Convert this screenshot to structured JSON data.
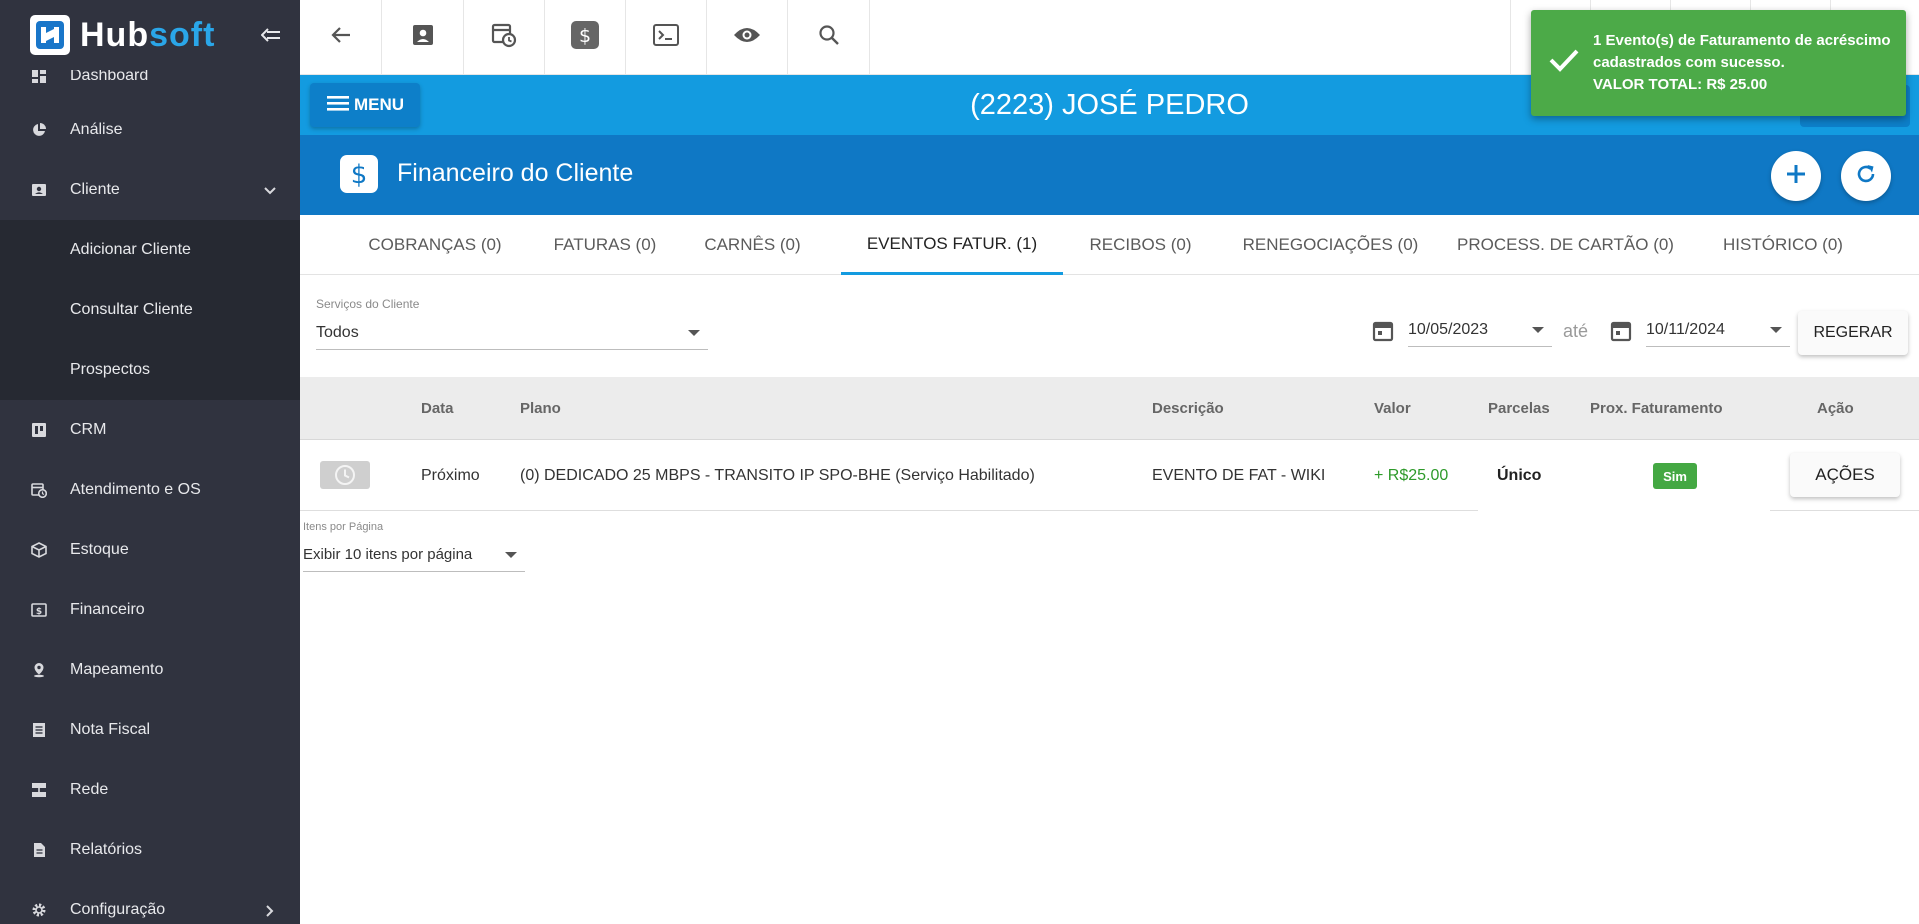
{
  "app": {
    "logo_hub": "Hub",
    "logo_soft": "soft"
  },
  "sidebar": {
    "items": [
      {
        "label": "Dashboard",
        "icon": "dashboard-icon"
      },
      {
        "label": "Análise",
        "icon": "pie-chart-icon"
      },
      {
        "label": "Cliente",
        "icon": "contact-card-icon",
        "expanded": true
      },
      {
        "label": "CRM",
        "icon": "crm-icon"
      },
      {
        "label": "Atendimento e OS",
        "icon": "calendar-clock-icon"
      },
      {
        "label": "Estoque",
        "icon": "box-icon"
      },
      {
        "label": "Financeiro",
        "icon": "money-icon"
      },
      {
        "label": "Mapeamento",
        "icon": "map-pin-icon"
      },
      {
        "label": "Nota Fiscal",
        "icon": "receipt-icon"
      },
      {
        "label": "Rede",
        "icon": "network-icon"
      },
      {
        "label": "Relatórios",
        "icon": "report-icon"
      },
      {
        "label": "Configuração",
        "icon": "gear-icon"
      }
    ],
    "subitems": [
      {
        "label": "Adicionar Cliente"
      },
      {
        "label": "Consultar Cliente"
      },
      {
        "label": "Prospectos"
      }
    ]
  },
  "toolbar": {
    "buttons": [
      "back-arrow-icon",
      "contact-card-icon",
      "calendar-clock-icon",
      "dollar-icon",
      "terminal-icon",
      "eye-icon",
      "search-icon"
    ]
  },
  "client_bar": {
    "menu_label": "MENU",
    "client_name": "(2223) JOSÉ PEDRO"
  },
  "section": {
    "title": "Financeiro do Cliente"
  },
  "tabs": [
    {
      "label": "COBRANÇAS (0)",
      "active": false
    },
    {
      "label": "FATURAS (0)",
      "active": false
    },
    {
      "label": "CARNÊS (0)",
      "active": false
    },
    {
      "label": "EVENTOS FATUR. (1)",
      "active": true
    },
    {
      "label": "RECIBOS (0)",
      "active": false
    },
    {
      "label": "RENEGOCIAÇÕES (0)",
      "active": false
    },
    {
      "label": "PROCESS. DE CARTÃO (0)",
      "active": false
    },
    {
      "label": "HISTÓRICO (0)",
      "active": false
    }
  ],
  "filters": {
    "services_label": "Serviços do Cliente",
    "services_value": "Todos",
    "date_from": "10/05/2023",
    "between": "até",
    "date_to": "10/11/2024",
    "regerar_label": "REGERAR"
  },
  "table": {
    "columns": [
      "Data",
      "Plano",
      "Descrição",
      "Valor",
      "Parcelas",
      "Prox. Faturamento",
      "Ação"
    ],
    "rows": [
      {
        "data": "Próximo",
        "plano": "(0) DEDICADO 25 MBPS - TRANSITO IP SPO-BHE (Serviço Habilitado)",
        "descricao": "EVENTO DE FAT - WIKI",
        "valor": "+ R$25.00",
        "parcelas": "Único",
        "prox_faturamento": "Sim",
        "acao": "AÇÕES"
      }
    ]
  },
  "pagination": {
    "label": "Itens por Página",
    "value": "Exibir 10 itens por página"
  },
  "toast": {
    "line1": "1 Evento(s) de Faturamento de acréscimo cadastrados com sucesso.",
    "line2": "VALOR TOTAL: R$ 25.00"
  },
  "colors": {
    "sidebar_bg": "#30333f",
    "client_bar": "#139be0",
    "section_header": "#0f78c5",
    "toast_bg": "#4caa48",
    "positive_value": "#2e9a2a",
    "badge_green": "#44a843"
  }
}
